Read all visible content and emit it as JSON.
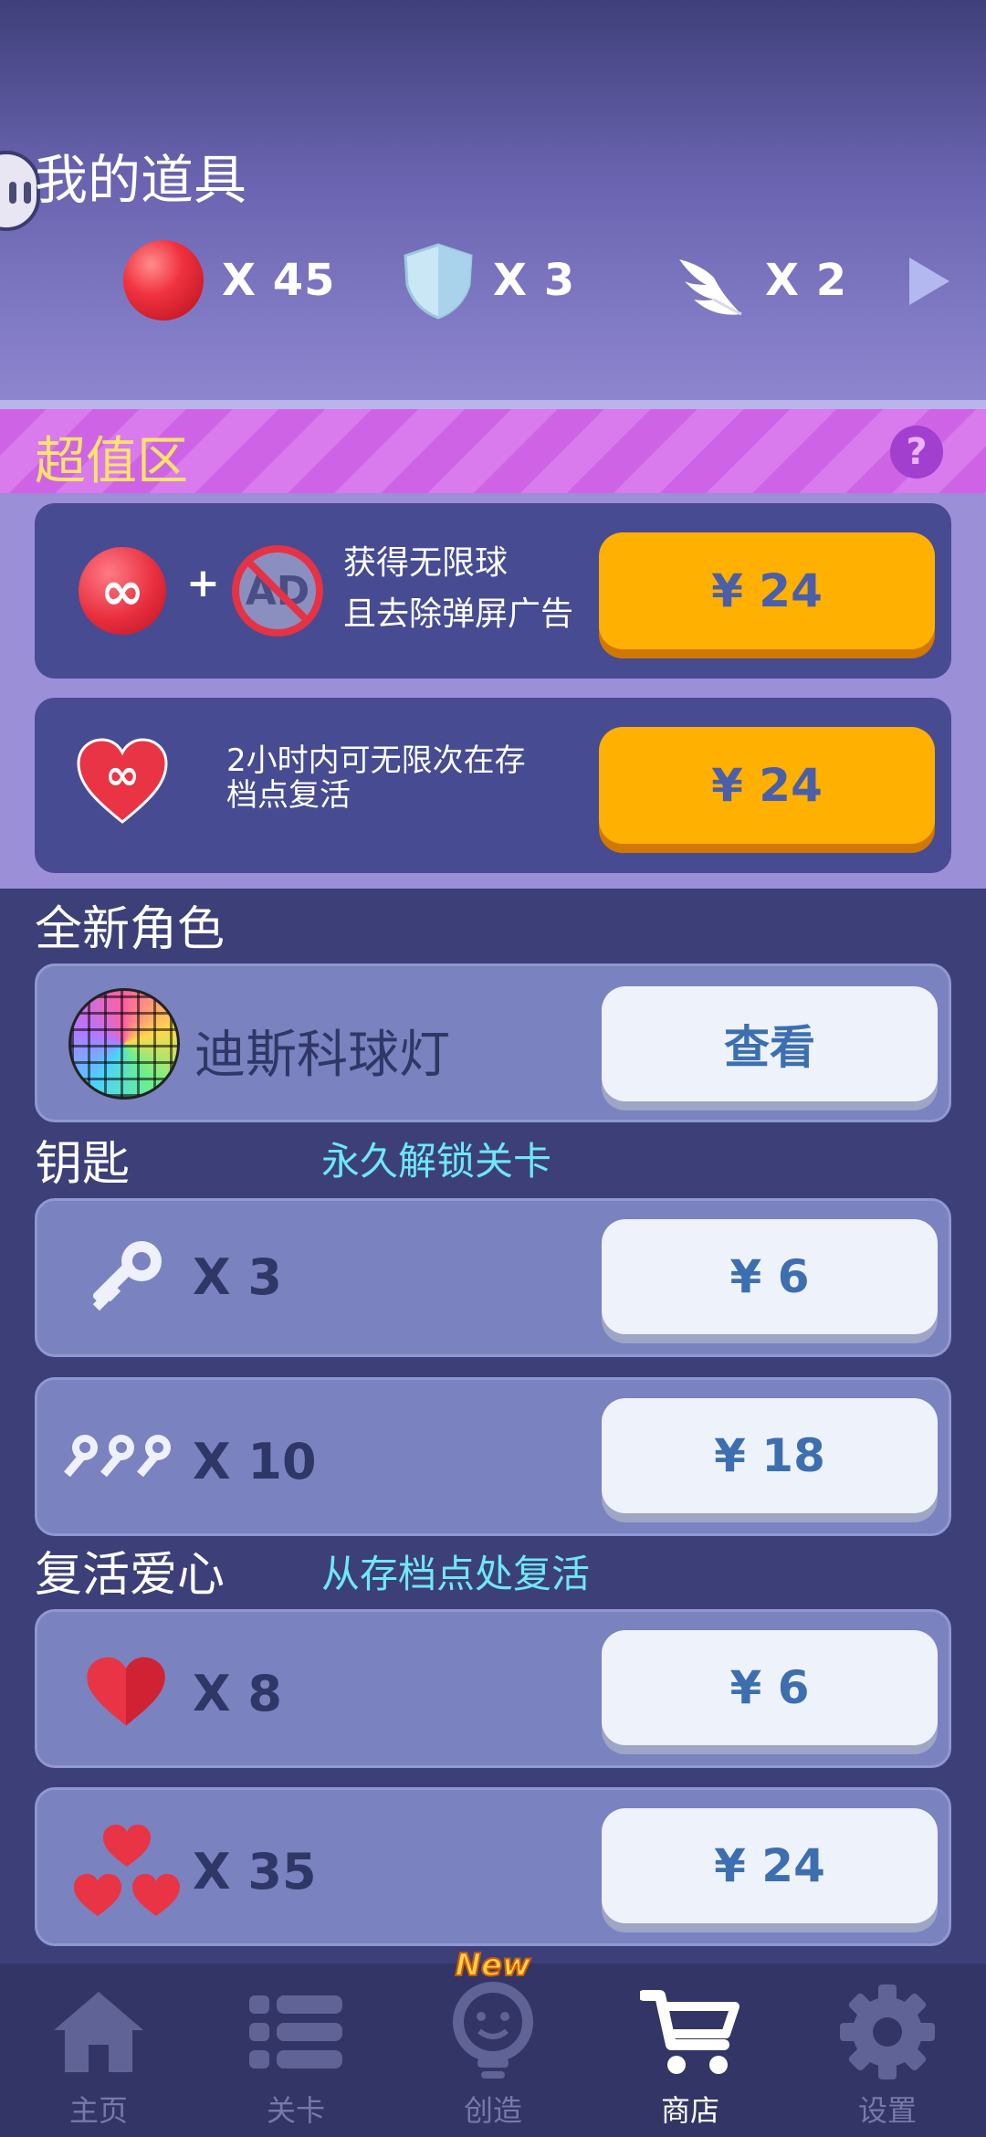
{
  "my_items": {
    "title": "我的道具",
    "balls": "X 45",
    "shields": "X 3",
    "wings": "X 2"
  },
  "value_zone": {
    "title": "超值区",
    "help": "?",
    "offer1": {
      "line1": "获得无限球",
      "line2": "且去除弹屏广告",
      "price": "¥ 24",
      "ad_text": "AD",
      "infinity": "∞",
      "plus": "+"
    },
    "offer2": {
      "line1": "2小时内可无限次在存",
      "line2": "档点复活",
      "price": "¥ 24",
      "infinity": "∞"
    }
  },
  "new_character": {
    "title": "全新角色",
    "name": "迪斯科球灯",
    "button": "查看"
  },
  "keys": {
    "title": "钥匙",
    "subtitle": "永久解锁关卡",
    "pack1": {
      "qty": "X 3",
      "price": "¥ 6"
    },
    "pack2": {
      "qty": "X 10",
      "price": "¥ 18"
    }
  },
  "hearts": {
    "title": "复活爱心",
    "subtitle": "从存档点处复活",
    "pack1": {
      "qty": "X 8",
      "price": "¥ 6"
    },
    "pack2": {
      "qty": "X 35",
      "price": "¥ 24"
    }
  },
  "nav": {
    "items": [
      {
        "label": "主页",
        "icon": "home-icon"
      },
      {
        "label": "关卡",
        "icon": "list-icon"
      },
      {
        "label": "创造",
        "icon": "lightbulb-icon",
        "badge": "New"
      },
      {
        "label": "商店",
        "icon": "cart-icon"
      },
      {
        "label": "设置",
        "icon": "gear-icon"
      }
    ],
    "active": "商店"
  },
  "colors": {
    "accent_orange": "#ffb000",
    "title_yellow": "#ffe36a",
    "subtitle_cyan": "#6ee8f5",
    "heart_red": "#ea3342"
  }
}
